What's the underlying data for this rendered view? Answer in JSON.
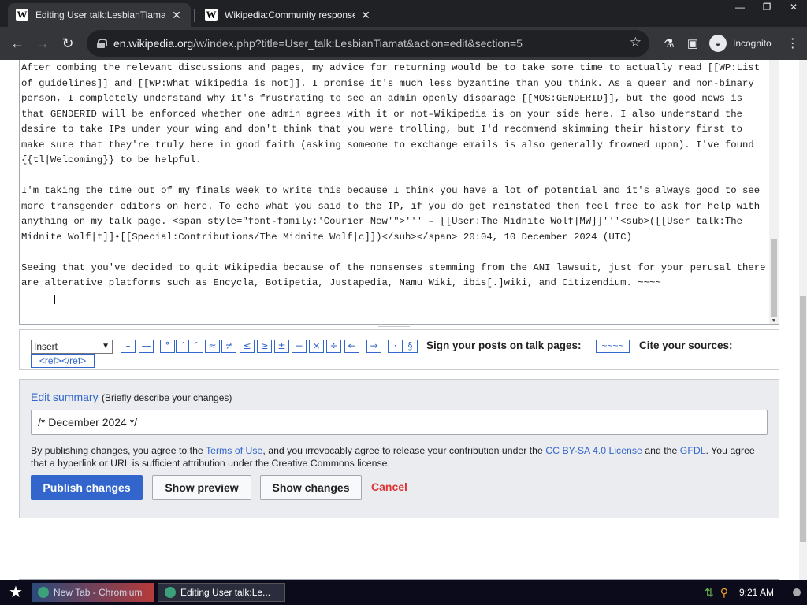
{
  "browser": {
    "tabs": [
      {
        "title": "Editing User talk:LesbianTiamat (sec",
        "favicon": "W",
        "active": true
      },
      {
        "title": "Wikipedia:Community response to A",
        "favicon": "W",
        "active": false
      }
    ],
    "close_glyph": "✕",
    "window_controls": {
      "minimize": "—",
      "restore": "❐",
      "close": "✕"
    },
    "url_host": "en.wikipedia.org",
    "url_path": "/w/index.php?title=User_talk:LesbianTiamat&action=edit&section=5",
    "profile_label": "Incognito"
  },
  "editor": {
    "paragraphs": [
      "After combing the relevant discussions and pages, my advice for returning would be to take some time to actually read [[WP:List of guidelines]] and [[WP:What Wikipedia is not]]. I promise it's much less byzantine than you think. As a queer and non-binary person, I completely understand why it's frustrating to see an admin openly disparage [[MOS:GENDERID]], but the good news is that GENDERID will be enforced whether one admin agrees with it or not–Wikipedia is on your side here. I also understand the desire to take IPs under your wing and don't think that you were trolling, but I'd recommend skimming their history first to make sure that they're truly here in good faith (asking someone to exchange emails is also generally frowned upon). I've found {{tl|Welcoming}} to be helpful.",
      "I'm taking the time out of my finals week to write this because I think you have a lot of potential and it's always good to see more transgender editors on here. To echo what you said to the IP, if you do get reinstated then feel free to ask for help with anything on my talk page. <span style=\"font-family:'Courier New'\">''' – [[User:The Midnite Wolf|MW]]'''<sub>([[User talk:The Midnite Wolf|t]]•[[Special:Contributions/The Midnite Wolf|c]])</sub></span> 20:04, 10 December 2024 (UTC)",
      "Seeing that you've decided to quit Wikipedia because of the nonsenses stemming from the ANI lawsuit, just for your perusal there are alterative platforms such as Encycla, Botipetia, Justapedia, Namu Wiki, ibis[.]wiki, and Citizendium. ~~~~"
    ]
  },
  "char_tools": {
    "insert_select": "Insert",
    "symbols": [
      "–",
      "—",
      "°",
      "′",
      "″",
      "≈",
      "≠",
      "≤",
      "≥",
      "±",
      "−",
      "×",
      "÷",
      "←",
      "→",
      "·",
      "§"
    ],
    "sign_label": "Sign your posts on talk pages:",
    "sign_button": "~~~~",
    "cite_label": "Cite your sources:",
    "ref_button": "<ref></ref>"
  },
  "edit_options": {
    "summary_label": "Edit summary",
    "summary_hint": "(Briefly describe your changes)",
    "summary_value": "/* December 2024 */",
    "license_1": "By publishing changes, you agree to the ",
    "terms_link": "Terms of Use",
    "license_2": ", and you irrevocably agree to release your contribution under the ",
    "ccbysa_link": "CC BY-SA 4.0 License",
    "license_3": " and the ",
    "gfdl_link": "GFDL",
    "license_4": ". You agree that a hyperlink or URL is sufficient attribution under the Creative Commons license.",
    "publish": "Publish changes",
    "preview": "Show preview",
    "changes": "Show changes",
    "cancel": "Cancel"
  },
  "taskbar": {
    "items": [
      "New Tab - Chromium",
      "Editing User talk:Le..."
    ],
    "clock": "9:21 AM"
  },
  "colors": {
    "link": "#3366cc",
    "primary_button": "#3366cc",
    "cancel": "#dd3333",
    "chrome_dark": "#202124"
  }
}
